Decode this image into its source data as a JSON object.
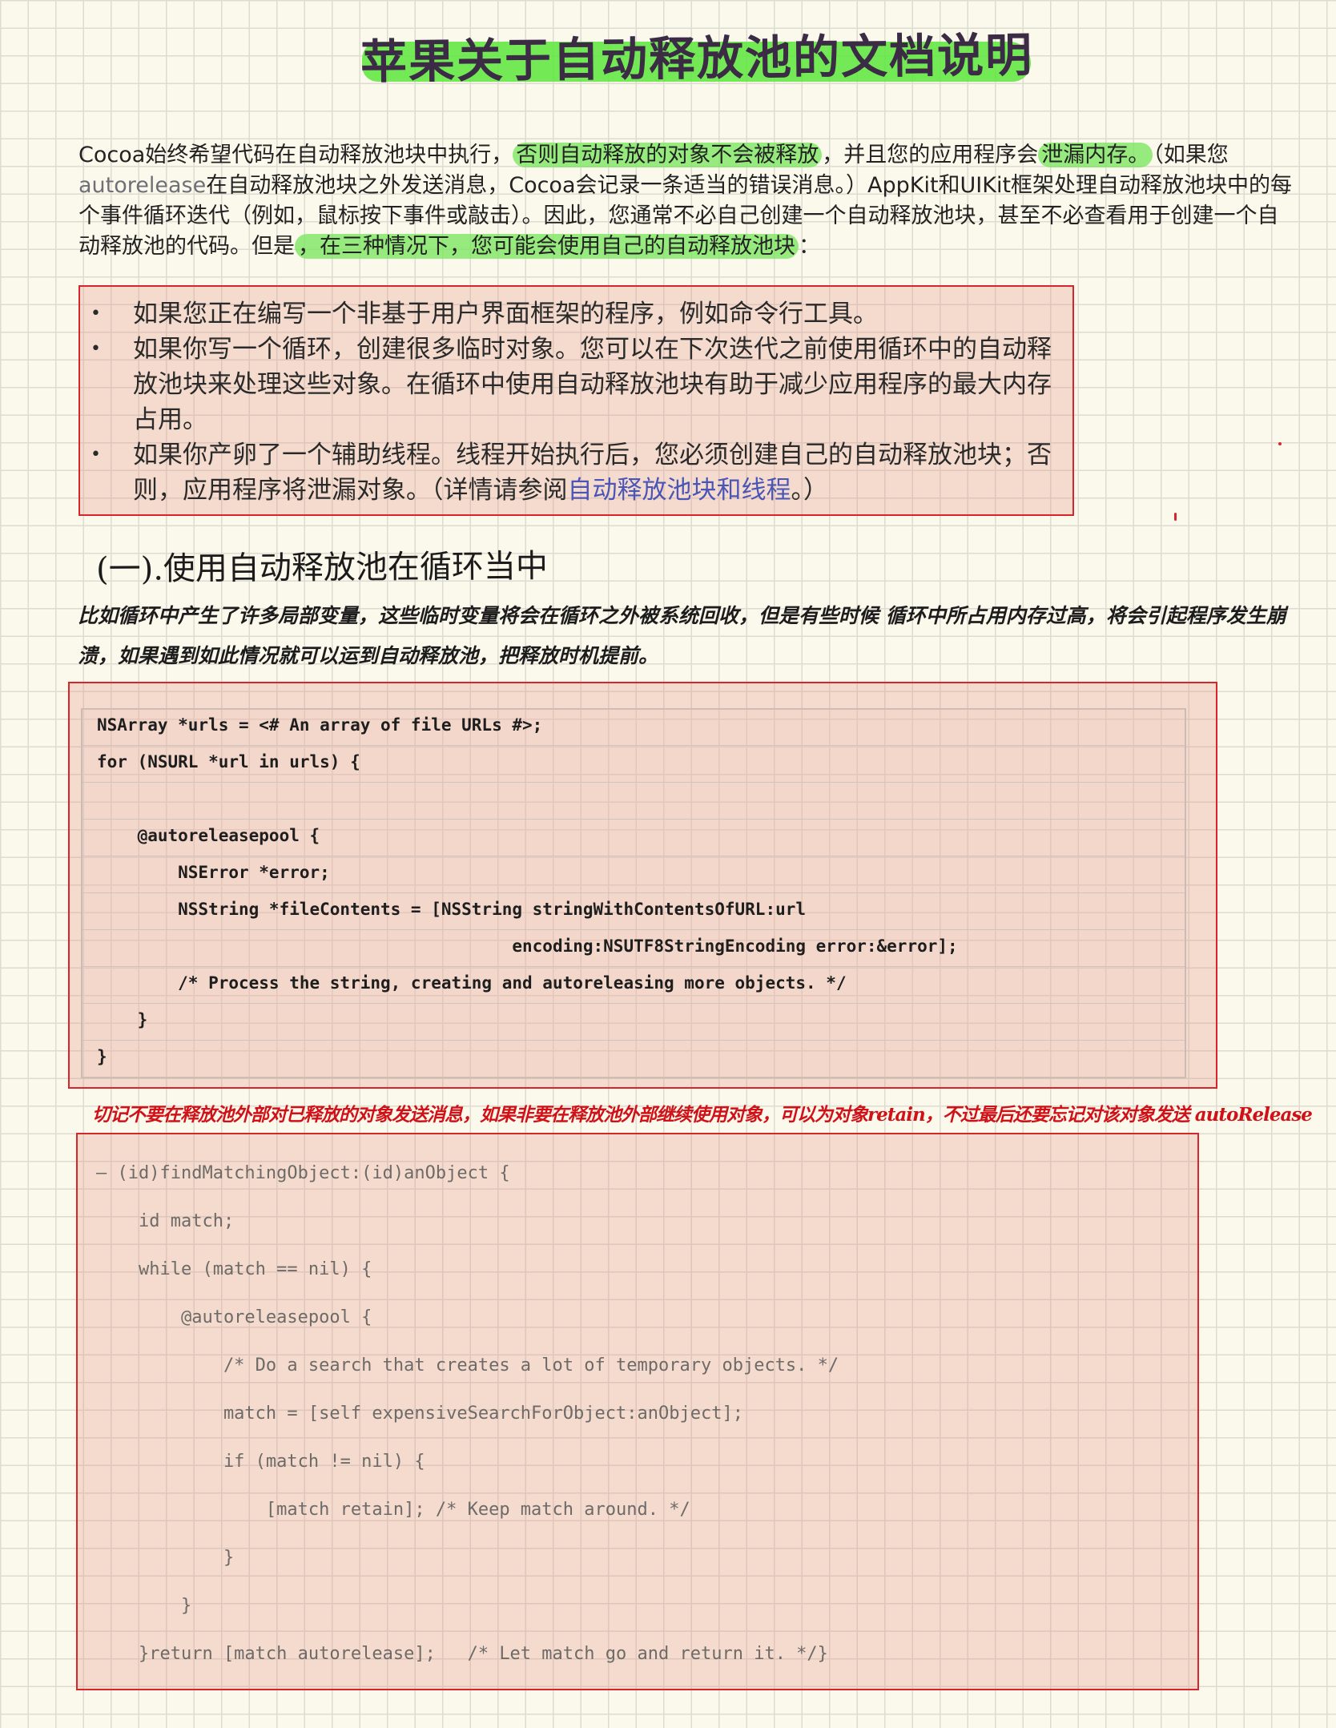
{
  "title": "苹果关于自动释放池的文档说明",
  "intro": {
    "p1": "Cocoa始终希望代码在自动释放池块中执行，",
    "hl1": "否则自动释放的对象不会被释放",
    "p2": "，并且您的应用程序会",
    "hl2": "泄漏内存。",
    "p3": "（如果您",
    "grey": "autorelease",
    "p4": "在自动释放池块之外发送消息，Cocoa会记录一条适当的错误消息。）AppKit和UIKit框架处理自动释放池块中的每个事件循环迭代（例如，鼠标按下事件或敲击）。因此，您通常不必自己创建一个自动释放池块，甚至不必查看用于创建一个自动释放池的代码。但是",
    "hl3": "，在三种情况下，您可能会使用自己的自动释放池块",
    "p5": "："
  },
  "bullets": [
    {
      "text": "如果您正在编写一个非基于用户界面框架的程序，例如命令行工具。",
      "link": ""
    },
    {
      "text": "如果你写一个循环，创建很多临时对象。您可以在下次迭代之前使用循环中的自动释放池块来处理这些对象。在循环中使用自动释放池块有助于减少应用程序的最大内存占用。",
      "link": ""
    },
    {
      "text": "如果你产卵了一个辅助线程。线程开始执行后，您必须创建自己的自动释放池块；否则，应用程序将泄漏对象。（详情请参阅",
      "link": "自动释放池块和线程",
      "tail": "。）"
    }
  ],
  "heading1": "(一).使用自动释放池在循环当中",
  "para1": "比如循环中产生了许多局部变量，这些临时变量将会在循环之外被系统回收，但是有些时候 循环中所占用内存过高，将会引起程序发生崩溃，如果遇到如此情况就可以运到自动释放池，把释放时机提前。",
  "code1": [
    "NSArray *urls = <# An array of file URLs #>;",
    "for (NSURL *url in urls) {",
    "",
    "    @autoreleasepool {",
    "        NSError *error;",
    "        NSString *fileContents = [NSString stringWithContentsOfURL:url",
    "                                         encoding:NSUTF8StringEncoding error:&error];",
    "        /* Process the string, creating and autoreleasing more objects. */",
    "    }",
    "}"
  ],
  "warning": "切记不要在释放池外部对已释放的对象发送消息，如果非要在释放池外部继续使用对象，可以为对象retain，不过最后还要忘记对该对象发送 autoRelease",
  "code2": [
    "— (id)findMatchingObject:(id)anObject {",
    "    id match;",
    "    while (match == nil) {",
    "        @autoreleasepool {",
    "            /* Do a search that creates a lot of temporary objects. */",
    "            match = [self expensiveSearchForObject:anObject];",
    "            if (match != nil) {",
    "                [match retain]; /* Keep match around. */",
    "            }",
    "        }",
    "    }return [match autorelease];   /* Let match go and return it. */}"
  ],
  "colors": {
    "highlight": "#76e65a",
    "annotation_red": "#d6252c",
    "link_blue": "#4a55b8",
    "paper": "#fbf9ec"
  }
}
